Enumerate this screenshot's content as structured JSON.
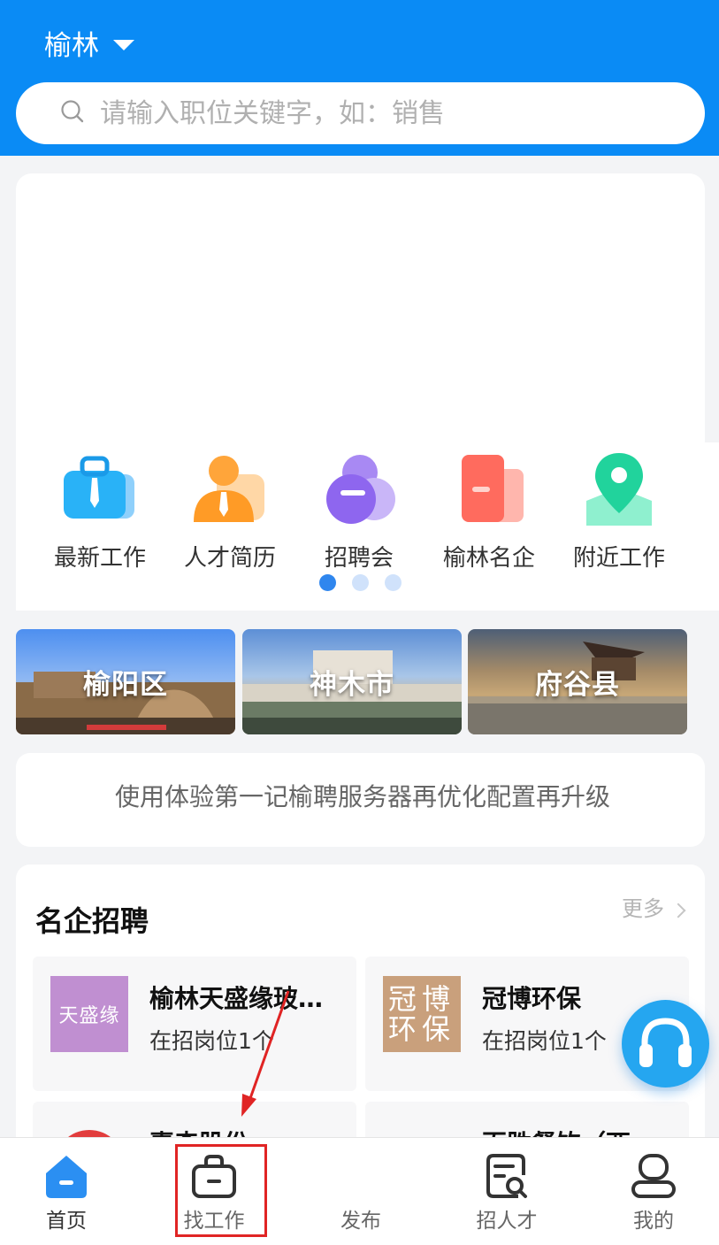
{
  "header": {
    "city": "榆林",
    "search_placeholder": "请输入职位关键字，如：销售"
  },
  "quick_links": [
    {
      "label": "最新工作",
      "icon": "briefcase-icon"
    },
    {
      "label": "人才简历",
      "icon": "person-icon"
    },
    {
      "label": "招聘会",
      "icon": "meeting-icon"
    },
    {
      "label": "榆林名企",
      "icon": "building-icon"
    },
    {
      "label": "附近工作",
      "icon": "location-pin-icon"
    }
  ],
  "carousel": {
    "pages": 3,
    "active": 1
  },
  "regions": [
    {
      "label": "榆阳区"
    },
    {
      "label": "神木市"
    },
    {
      "label": "府谷县"
    }
  ],
  "notice": {
    "text": "使用体验第一记榆聘服务器再优化配置再升级"
  },
  "famous_companies": {
    "title": "名企招聘",
    "more_label": "更多",
    "items": [
      {
        "name": "榆林天盛缘玻…",
        "count": "在招岗位1个",
        "logo_text": "天盛缘"
      },
      {
        "name": "冠博环保",
        "count": "在招岗位1个",
        "logo_text": "冠博环保"
      },
      {
        "name": "惠森股份",
        "count": ""
      },
      {
        "name": "百胜餐饮（西…",
        "count": ""
      }
    ]
  },
  "tabbar": [
    {
      "label": "首页",
      "icon": "home-icon",
      "active": true
    },
    {
      "label": "找工作",
      "icon": "job-bag-icon"
    },
    {
      "label": "发布",
      "icon": "publish-icon"
    },
    {
      "label": "招人才",
      "icon": "recruit-search-icon"
    },
    {
      "label": "我的",
      "icon": "profile-icon"
    }
  ],
  "colors": {
    "brand_blue": "#0a8bf5",
    "annotation_red": "#e02424"
  }
}
